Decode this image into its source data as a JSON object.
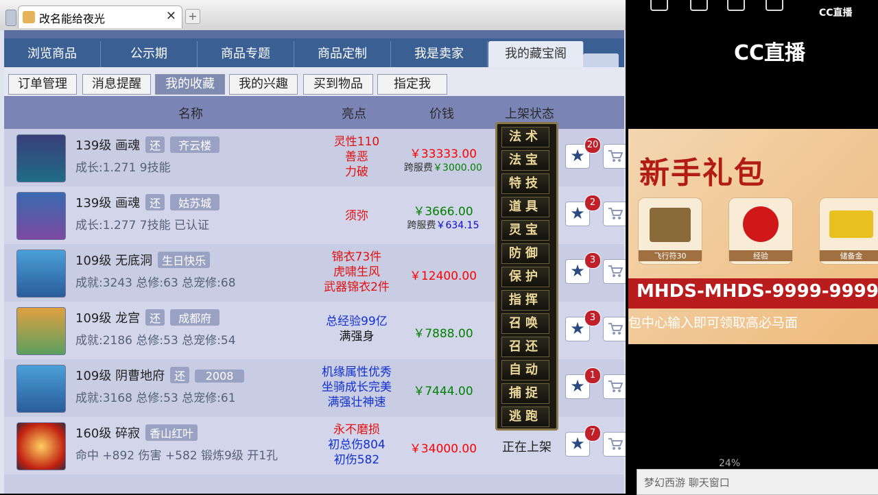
{
  "window": {
    "tab_title": "改名能给夜光",
    "new_tab": "+"
  },
  "nav": {
    "tabs": [
      "浏览商品",
      "公示期",
      "商品专题",
      "商品定制",
      "我是卖家",
      "我的藏宝阁"
    ],
    "active": 5
  },
  "subnav": {
    "buttons": [
      "订单管理",
      "消息提醒",
      "我的收藏",
      "我的兴趣",
      "买到物品",
      "指定我"
    ],
    "active": 2
  },
  "table": {
    "headers": {
      "name": "名称",
      "highlight": "亮点",
      "price": "价钱",
      "status": "上架状态"
    },
    "rows": [
      {
        "level": "139级",
        "school": "画魂",
        "tag1": "还",
        "tag2": "齐云楼",
        "line2": "成长:1.271 9技能",
        "highlights": [
          "灵性110",
          "善恶",
          "力破"
        ],
        "hl_color": "red",
        "price": "￥33333.00",
        "fee_label": "跨服费",
        "fee": "￥3000.00",
        "status": "",
        "stars": "20"
      },
      {
        "level": "139级",
        "school": "画魂",
        "tag1": "还",
        "tag2": "姑苏城",
        "line2": "成长:1.277 7技能 已认证",
        "highlights": [
          "须弥"
        ],
        "hl_color": "red",
        "price": "￥3666.00",
        "fee_label": "跨服费",
        "fee": "￥634.15",
        "status": "",
        "stars": "2"
      },
      {
        "level": "109级",
        "school": "无底洞",
        "tag1": "",
        "tag2": "生日快乐",
        "line2": "成就:3243 总修:63 总宠修:68",
        "highlights": [
          "锦衣73件",
          "虎啸生风",
          "武器锦衣2件"
        ],
        "hl_color": "red",
        "price": "￥12400.00",
        "fee_label": "",
        "fee": "",
        "status": "",
        "stars": "3"
      },
      {
        "level": "109级",
        "school": "龙宫",
        "tag1": "还",
        "tag2": "成都府",
        "line2": "成就:2186 总修:53 总宠修:54",
        "highlights": [
          "总经验99亿",
          "满强身"
        ],
        "hl_color": "blue",
        "price": "￥7888.00",
        "fee_label": "",
        "fee": "",
        "status": "",
        "stars": "3"
      },
      {
        "level": "109级",
        "school": "阴曹地府",
        "tag1": "还",
        "tag2": "2008",
        "line2": "成就:3168 总修:53 总宠修:61",
        "highlights": [
          "机缘属性优秀",
          "坐骑成长完美",
          "满强壮神速"
        ],
        "hl_color": "blue",
        "price": "￥7444.00",
        "fee_label": "",
        "fee": "",
        "status": "",
        "stars": "1"
      },
      {
        "level": "160级",
        "school": "碎寂",
        "tag1": "",
        "tag2": "香山红叶",
        "line2": "命中 +892 伤害 +582 锻炼9级 开1孔",
        "highlights": [
          "永不磨损",
          "初总伤804",
          "初伤582"
        ],
        "hl_color": "mixed",
        "price": "￥34000.00",
        "fee_label": "",
        "fee": "",
        "status": "正在上架",
        "stars": "7"
      }
    ]
  },
  "skill_menu": [
    "法术",
    "法宝",
    "特技",
    "道具",
    "灵宝",
    "防御",
    "保护",
    "指挥",
    "召唤",
    "召还",
    "自动",
    "捕捉",
    "逃跑"
  ],
  "right_panel": {
    "cc_small": "CC直播",
    "cc_big": "CC直播",
    "banner_title": "新手礼包",
    "gifts": [
      "飞行符30",
      "经验",
      "储备金"
    ],
    "code": "MHDS-MHDS-9999-9999",
    "hint": "包中心输入即可领取高必马面",
    "zoom": "24%",
    "chat_placeholder": "梦幻西游 聊天窗口"
  },
  "colors": {
    "price": "#ff0000",
    "price_green": "#008000",
    "nav": "#3a5f93",
    "header": "#7a85b5"
  }
}
